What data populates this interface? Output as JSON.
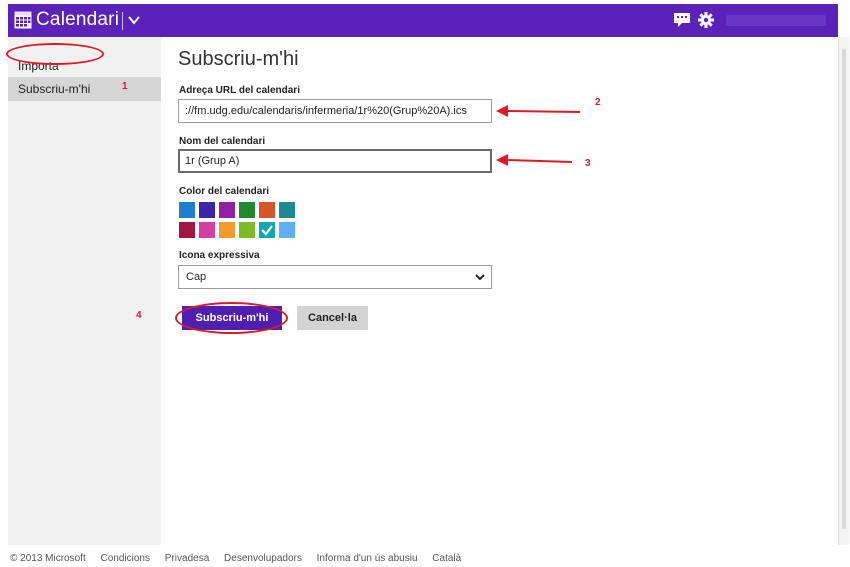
{
  "header": {
    "app_title": "Calendari",
    "icons": [
      "calendar-icon",
      "chevron-down-icon",
      "chat-icon",
      "gear-icon"
    ]
  },
  "sidebar": {
    "items": [
      {
        "label": "Importa",
        "active": false
      },
      {
        "label": "Subscriu-m'hi",
        "active": true
      }
    ]
  },
  "main": {
    "title": "Subscriu-m'hi",
    "url_label": "Adreça URL del calendari",
    "url_value": "://fm.udg.edu/calendaris/infermeria/1r%20(Grup%20A).ics",
    "name_label": "Nom del calendari",
    "name_value": "1r (Grup A)",
    "color_label": "Color del calendari",
    "colors_row1": [
      "#1e7fd1",
      "#3e22a8",
      "#8f22a3",
      "#218a2f",
      "#d5542a",
      "#1e8a90"
    ],
    "colors_row2": [
      "#a2163f",
      "#d33fa2",
      "#f39a30",
      "#7dba27",
      "#13a6b0",
      "#5fb0f2"
    ],
    "selected_color": "#13a6b0",
    "icon_label": "Icona expressiva",
    "icon_value": "Cap",
    "subscribe_button": "Subscriu-m'hi",
    "cancel_button": "Cancel·la"
  },
  "annotations": {
    "n1": "1",
    "n2": "2",
    "n3": "3",
    "n4": "4",
    "color": "#e0192a"
  },
  "footer": {
    "copyright": "© 2013 Microsoft",
    "links": [
      "Condicions",
      "Privadesa",
      "Desenvolupadors",
      "Informa d'un ús abusiu",
      "Català"
    ]
  }
}
